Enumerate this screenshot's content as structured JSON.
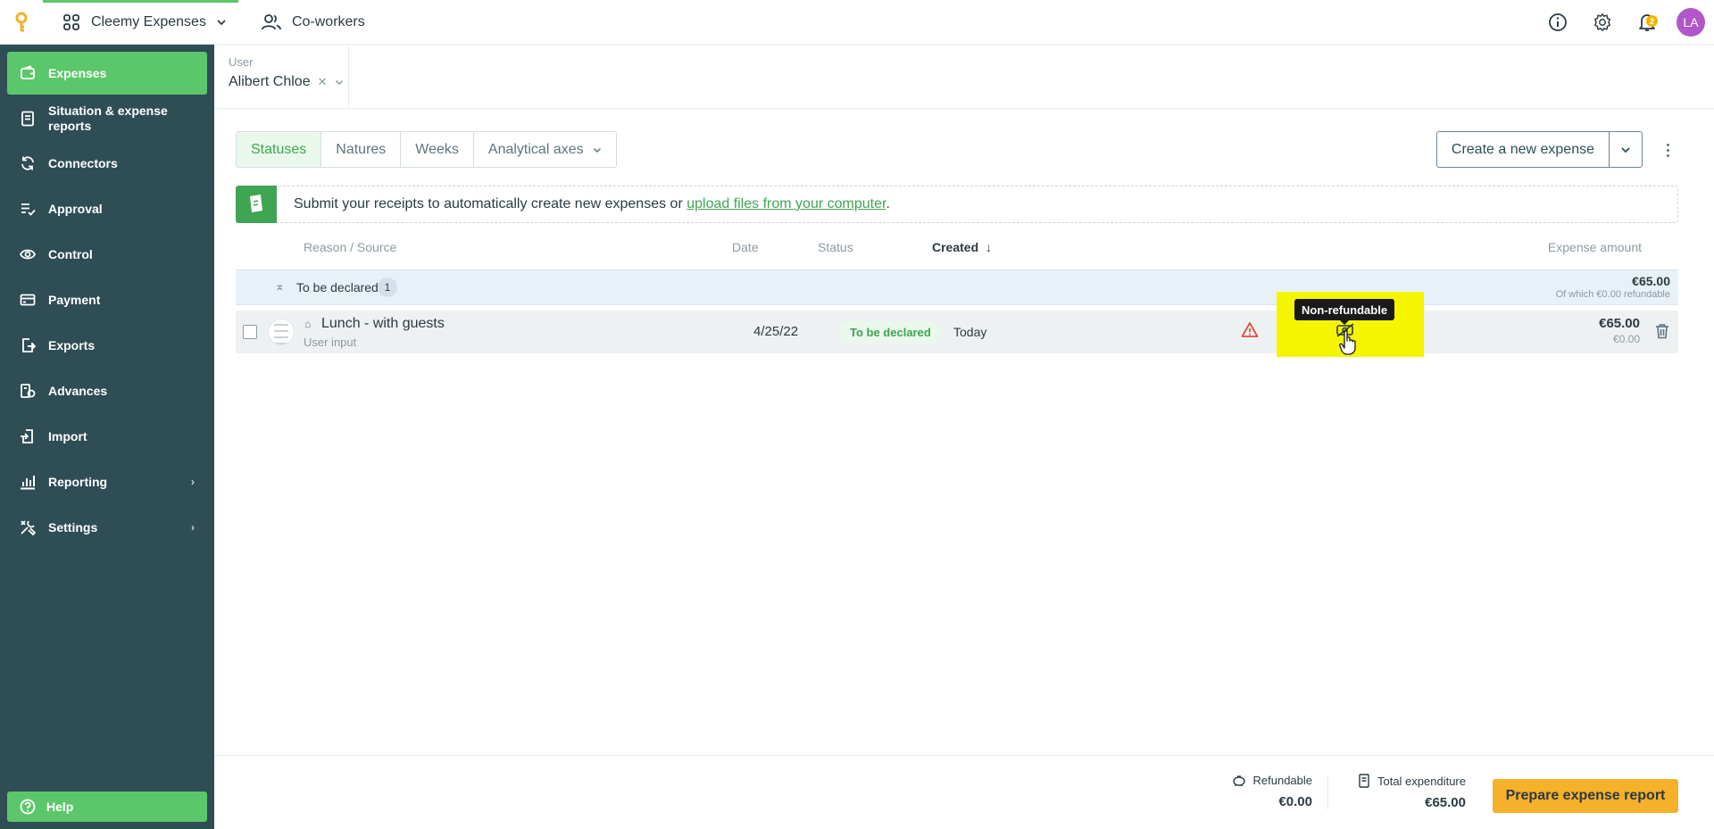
{
  "topbar": {
    "app_name": "Cleemy Expenses",
    "coworkers": "Co-workers",
    "notification_count": "2",
    "avatar_initials": "LA"
  },
  "sidebar": {
    "items": [
      {
        "label": "Expenses",
        "icon": "wallet-icon"
      },
      {
        "label": "Situation & expense reports",
        "icon": "report-icon"
      },
      {
        "label": "Connectors",
        "icon": "sync-icon"
      },
      {
        "label": "Approval",
        "icon": "approval-icon"
      },
      {
        "label": "Control",
        "icon": "eye-icon"
      },
      {
        "label": "Payment",
        "icon": "card-icon"
      },
      {
        "label": "Exports",
        "icon": "export-icon"
      },
      {
        "label": "Advances",
        "icon": "advances-icon"
      },
      {
        "label": "Import",
        "icon": "import-icon"
      },
      {
        "label": "Reporting",
        "icon": "chart-icon"
      },
      {
        "label": "Settings",
        "icon": "tools-icon"
      }
    ],
    "help": "Help"
  },
  "filter": {
    "user_label": "User",
    "user_value": "Alibert Chloe"
  },
  "tabs": [
    "Statuses",
    "Natures",
    "Weeks",
    "Analytical axes"
  ],
  "actions": {
    "create": "Create a new expense"
  },
  "dropzone": {
    "text": "Submit your receipts to automatically create new expenses or ",
    "link": "upload files from your computer",
    "suffix": "."
  },
  "columns": {
    "reason": "Reason / Source",
    "date": "Date",
    "status": "Status",
    "created": "Created",
    "amount": "Expense amount"
  },
  "group": {
    "label": "To be declared",
    "count": "1",
    "total": "€65.00",
    "refundable_note": "Of which €0.00 refundable"
  },
  "expense": {
    "reason": "Lunch - with guests",
    "source": "User input",
    "date": "4/25/22",
    "status": "To be declared",
    "created": "Today",
    "amount": "€65.00",
    "refundable": "€0.00"
  },
  "tooltip": "Non-refundable",
  "footer": {
    "refundable_label": "Refundable",
    "refundable_value": "€0.00",
    "total_label": "Total expenditure",
    "total_value": "€65.00",
    "prepare": "Prepare expense report"
  },
  "colors": {
    "accent": "#5cc76a",
    "sidebar": "#2e4d55",
    "primary_button": "#f5b12a",
    "avatar": "#b257c9"
  }
}
